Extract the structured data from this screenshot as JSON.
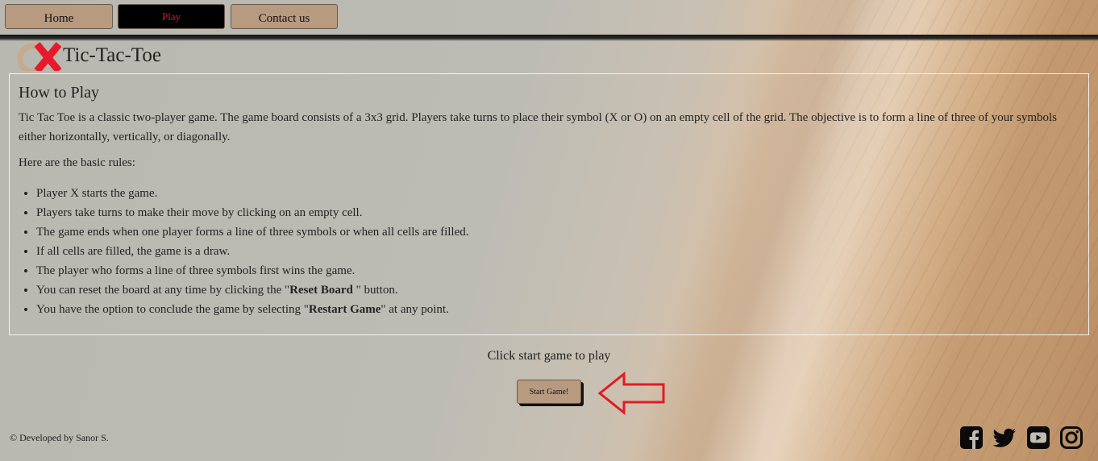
{
  "nav": {
    "home": "Home",
    "play": "Play",
    "contact": "Contact us"
  },
  "header": {
    "logo_text": "OX",
    "title": "Tic-Tac-Toe"
  },
  "how_to_play": {
    "heading": "How to Play",
    "intro": "Tic Tac Toe is a classic two-player game. The game board consists of a 3x3 grid. Players take turns to place their symbol (X or O) on an empty cell of the grid. The objective is to form a line of three of your symbols either horizontally, vertically, or diagonally.",
    "basic": "Here are the basic rules:",
    "rules": [
      "Player X starts the game.",
      "Players take turns to make their move by clicking on an empty cell.",
      "The game ends when one player forms a line of three symbols or when all cells are filled.",
      "If all cells are filled, the game is a draw.",
      "The player who forms a line of three symbols first wins the game."
    ],
    "rule_reset": {
      "before": "You can reset the board at any time by clicking the \"",
      "bold": "Reset Board",
      "after": " \" button."
    },
    "rule_restart": {
      "before": "You have the option to conclude the game by selecting \"",
      "bold": "Restart Game",
      "after": "\" at any point."
    }
  },
  "play": {
    "prompt": "Click start game to play",
    "start_label": "Start Game!"
  },
  "footer": {
    "copyright": "© Developed by Sanor S."
  },
  "social_icons": [
    "facebook-icon",
    "twitter-icon",
    "youtube-icon",
    "instagram-icon"
  ],
  "colors": {
    "button_bg": "#b89a80",
    "active_bg": "#000000",
    "active_text": "#c8202a",
    "logo_x": "#e8192c",
    "arrow": "#e31b23"
  }
}
